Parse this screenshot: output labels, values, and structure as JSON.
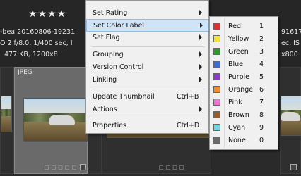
{
  "background": {
    "stars": "★★★★",
    "left_meta": [
      "-bea 20160806-19231",
      "O 2 f/8.0, 1/400 sec, I",
      "477 KB, 1200x8"
    ],
    "right_meta": [
      "91617",
      "ec, IS",
      "x800"
    ],
    "selected_cell_label": "JPEG"
  },
  "context_menu": {
    "items": [
      {
        "label": "Set Rating",
        "shortcut": "",
        "submenu": true
      },
      {
        "label": "Set Color Label",
        "shortcut": "",
        "submenu": true,
        "highlighted": true
      },
      {
        "label": "Set Flag",
        "shortcut": "",
        "submenu": true
      },
      {
        "label": "Grouping",
        "shortcut": "",
        "submenu": true
      },
      {
        "label": "Version Control",
        "shortcut": "",
        "submenu": true
      },
      {
        "label": "Linking",
        "shortcut": "",
        "submenu": true
      },
      {
        "label": "Update Thumbnail",
        "shortcut": "Ctrl+B",
        "submenu": false
      },
      {
        "label": "Actions",
        "shortcut": "",
        "submenu": true
      },
      {
        "label": "Properties",
        "shortcut": "Ctrl+D",
        "submenu": false
      }
    ]
  },
  "color_label_submenu": {
    "items": [
      {
        "name": "Red",
        "key": "1",
        "color": "#e03030"
      },
      {
        "name": "Yellow",
        "key": "2",
        "color": "#f2e62a"
      },
      {
        "name": "Green",
        "key": "3",
        "color": "#2e9a2e"
      },
      {
        "name": "Blue",
        "key": "4",
        "color": "#3a6fd8"
      },
      {
        "name": "Purple",
        "key": "5",
        "color": "#8a3cc8"
      },
      {
        "name": "Orange",
        "key": "6",
        "color": "#f08a24"
      },
      {
        "name": "Pink",
        "key": "7",
        "color": "#f070d0"
      },
      {
        "name": "Brown",
        "key": "8",
        "color": "#9a5a2a"
      },
      {
        "name": "Cyan",
        "key": "9",
        "color": "#6fd6e0"
      },
      {
        "name": "None",
        "key": "0",
        "color": "#6a6a6a"
      }
    ]
  }
}
